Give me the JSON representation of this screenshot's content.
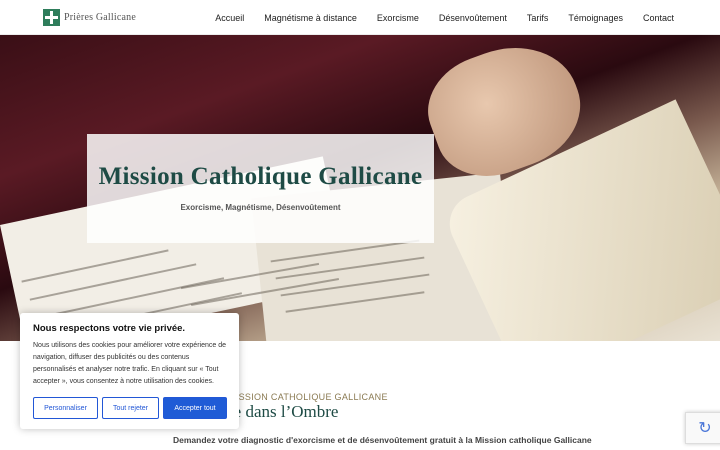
{
  "site": {
    "logo_text": "Prières Gallicane",
    "logo_icon": "cross-icon"
  },
  "nav": {
    "items": [
      {
        "label": "Accueil"
      },
      {
        "label": "Magnétisme à distance"
      },
      {
        "label": "Exorcisme"
      },
      {
        "label": "Désenvoûtement"
      },
      {
        "label": "Tarifs"
      },
      {
        "label": "Témoignages"
      },
      {
        "label": "Contact"
      }
    ]
  },
  "hero": {
    "title": "Mission Catholique Gallicane",
    "subtitle": "Exorcisme, Magnétisme, Désenvoûtement"
  },
  "section": {
    "kicker": "MISSION CATHOLIQUE GALLICANE",
    "title": "re dans l’Ombre",
    "description": "Demandez votre diagnostic d'exorcisme et de désenvoûtement gratuit à la Mission catholique Gallicane"
  },
  "cookie": {
    "title": "Nous respectons votre vie privée.",
    "text": "Nous utilisons des cookies pour améliorer votre expérience de navigation, diffuser des publicités ou des contenus personnalisés et analyser notre trafic. En cliquant sur « Tout accepter », vous consentez à notre utilisation des cookies.",
    "customize_label": "Personnaliser",
    "reject_label": "Tout rejeter",
    "accept_label": "Accepter tout"
  },
  "colors": {
    "brand_green": "#1e4b45",
    "accent_gold": "#8a7a52",
    "button_blue": "#1f5bd6"
  },
  "recaptcha": {
    "icon": "recaptcha-icon"
  }
}
